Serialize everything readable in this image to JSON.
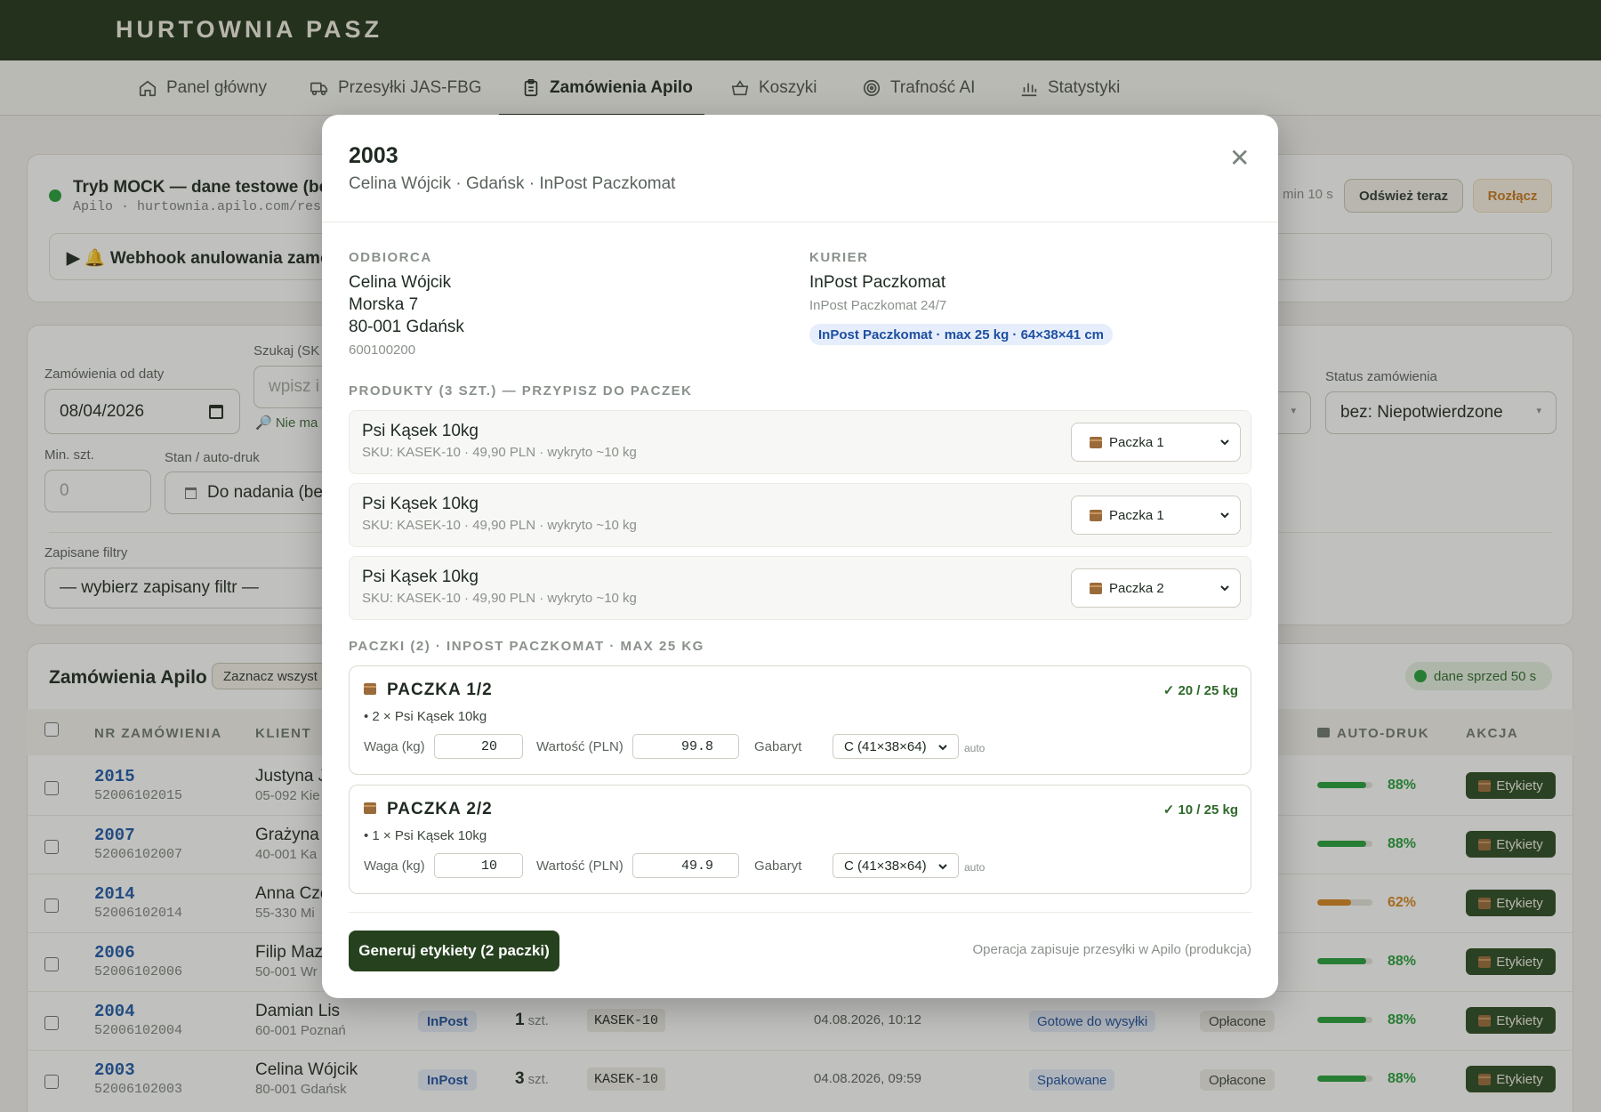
{
  "app": {
    "brand": "HURTOWNIA PASZ"
  },
  "nav": [
    {
      "label": "Panel główny",
      "icon": "home-icon"
    },
    {
      "label": "Przesyłki JAS-FBG",
      "icon": "truck-icon"
    },
    {
      "label": "Zamówienia Apilo",
      "icon": "clipboard-icon",
      "active": true
    },
    {
      "label": "Koszyki",
      "icon": "basket-icon"
    },
    {
      "label": "Trafność AI",
      "icon": "target-icon"
    },
    {
      "label": "Statystyki",
      "icon": "bar-chart-icon"
    }
  ],
  "status_card": {
    "title": "Tryb MOCK — dane testowe (bez",
    "endpoint": "Apilo · hurtownia.apilo.com/rest/a",
    "webhook": "▶ 🔔 Webhook anulowania zamów",
    "timer": "min 10 s",
    "refresh_label": "Odśwież teraz",
    "disconnect_label": "Rozłącz"
  },
  "filters": {
    "date_label": "Zamówienia od daty",
    "date_value": "08/04/2026",
    "search_label": "Szukaj (SK",
    "search_placeholder": "wpisz i",
    "search_hint": "🔎 Nie ma",
    "min_label": "Min. szt.",
    "min_placeholder": "0",
    "state_label": "Stan / auto-druk",
    "state_value": "Do nadania (bez",
    "status_label": "Status zamówienia",
    "status_value": "bez: Niepotwierdzone",
    "saved_label": "Zapisane filtry",
    "saved_value": "— wybierz zapisany filtr —"
  },
  "orders": {
    "title": "Zamówienia Apilo",
    "select_all": "Zaznacz wszyst",
    "freshness": "dane sprzed 50 s",
    "columns": {
      "nr": "NR ZAMÓWIENIA",
      "client": "KLIENT",
      "autoprint": "AUTO-DRUK",
      "action": "AKCJA"
    },
    "autoprint_icon": "printer-icon",
    "label_button": "Etykiety",
    "rows": [
      {
        "nr": "2015",
        "ext": "52006102015",
        "client": "Justyna J",
        "addr": "05-092 Kie",
        "pct_label": "88%",
        "pct": 88,
        "color": "#26a03a"
      },
      {
        "nr": "2007",
        "ext": "52006102007",
        "client": "Grażyna S",
        "addr": "40-001 Ka",
        "pct_label": "88%",
        "pct": 88,
        "color": "#26a03a"
      },
      {
        "nr": "2014",
        "ext": "52006102014",
        "client": "Anna Cze",
        "addr": "55-330 Mi",
        "pct_label": "62%",
        "pct": 62,
        "color": "#d8861f"
      },
      {
        "nr": "2006",
        "ext": "52006102006",
        "client": "Filip Mazu",
        "addr": "50-001 Wr",
        "pct_label": "88%",
        "pct": 88,
        "color": "#26a03a"
      },
      {
        "nr": "2004",
        "ext": "52006102004",
        "client": "Damian Lis",
        "addr": "60-001 Poznań",
        "carrier": "InPost",
        "qty": "1",
        "qty_unit": "szt.",
        "sku": "KASEK-10",
        "date": "04.08.2026, 10:12",
        "status": "Gotowe do wysyłki",
        "payment": "Opłacone",
        "pct_label": "88%",
        "pct": 88,
        "color": "#26a03a"
      },
      {
        "nr": "2003",
        "ext": "52006102003",
        "client": "Celina Wójcik",
        "addr": "80-001 Gdańsk",
        "carrier": "InPost",
        "qty": "3",
        "qty_unit": "szt.",
        "sku": "KASEK-10",
        "date": "04.08.2026, 09:59",
        "status": "Spakowane",
        "payment": "Opłacone",
        "pct_label": "88%",
        "pct": 88,
        "color": "#26a03a"
      }
    ]
  },
  "modal": {
    "title": "2003",
    "subtitle": "Celina Wójcik · Gdańsk · InPost Paczkomat",
    "recipient_caption": "ODBIORCA",
    "recipient_name": "Celina Wójcik",
    "recipient_street": "Morska 7",
    "recipient_city": "80-001 Gdańsk",
    "recipient_phone": "600100200",
    "courier_caption": "KURIER",
    "courier_name": "InPost Paczkomat",
    "courier_service": "InPost Paczkomat 24/7",
    "courier_limits": "InPost Paczkomat · max 25 kg · 64×38×41 cm",
    "products_caption": "PRODUKTY (3 SZT.) — PRZYPISZ DO PACZEK",
    "products": [
      {
        "name": "Psi Kąsek 10kg",
        "meta": "SKU: KASEK-10 · 49,90 PLN · wykryto ~10 kg",
        "package": "Paczka 1"
      },
      {
        "name": "Psi Kąsek 10kg",
        "meta": "SKU: KASEK-10 · 49,90 PLN · wykryto ~10 kg",
        "package": "Paczka 1"
      },
      {
        "name": "Psi Kąsek 10kg",
        "meta": "SKU: KASEK-10 · 49,90 PLN · wykryto ~10 kg",
        "package": "Paczka 2"
      }
    ],
    "packages_caption": "PACZKI (2) · INPOST PACZKOMAT · MAX 25 KG",
    "packages": [
      {
        "title": "PACZKA 1/2",
        "check": "✓ 20 / 25 kg",
        "items": "• 2 × Psi Kąsek 10kg",
        "weight_label": "Waga (kg)",
        "weight": "20",
        "value_label": "Wartość (PLN)",
        "value": "99.8",
        "size_label": "Gabaryt",
        "size": "C (41×38×64)",
        "auto": "auto"
      },
      {
        "title": "PACZKA 2/2",
        "check": "✓ 10 / 25 kg",
        "items": "• 1 × Psi Kąsek 10kg",
        "weight_label": "Waga (kg)",
        "weight": "10",
        "value_label": "Wartość (PLN)",
        "value": "49.9",
        "size_label": "Gabaryt",
        "size": "C (41×38×64)",
        "auto": "auto"
      }
    ],
    "generate_label": "Generuj etykiety (2 paczki)",
    "footer_note": "Operacja zapisuje przesyłki w Apilo (produkcja)"
  }
}
